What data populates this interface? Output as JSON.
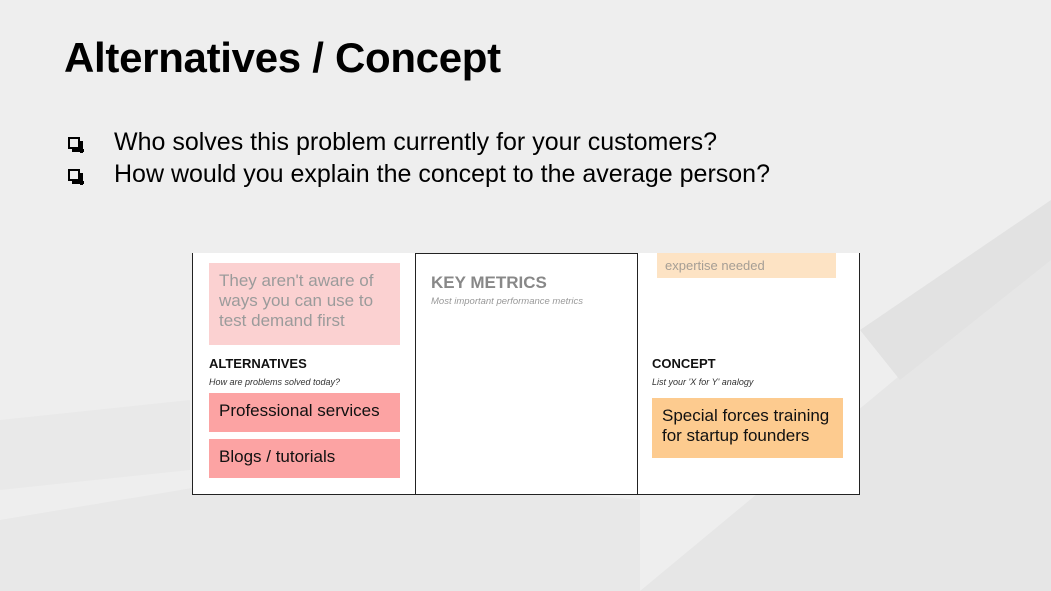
{
  "slide": {
    "title": "Alternatives / Concept",
    "bullets": [
      "Who solves this problem currently for your customers?",
      "How would you explain the concept to the average person?"
    ]
  },
  "canvas": {
    "alternatives": {
      "faded_note": "They aren't aware of ways you can use to test demand first",
      "heading": "ALTERNATIVES",
      "subheading": "How are problems solved today?",
      "notes": [
        "Professional services",
        "Blogs / tutorials"
      ]
    },
    "key_metrics": {
      "heading": "KEY METRICS",
      "subheading": "Most important performance metrics"
    },
    "concept": {
      "faded_note": "expertise needed",
      "heading": "CONCEPT",
      "subheading": "List your 'X for Y' analogy",
      "note": "Special forces training for startup founders"
    }
  },
  "colors": {
    "note_red": "#fca3a3",
    "note_red_faded": "#fbd1d1",
    "note_orange": "#fdcb8f",
    "note_orange_faded": "#fde3c4"
  }
}
